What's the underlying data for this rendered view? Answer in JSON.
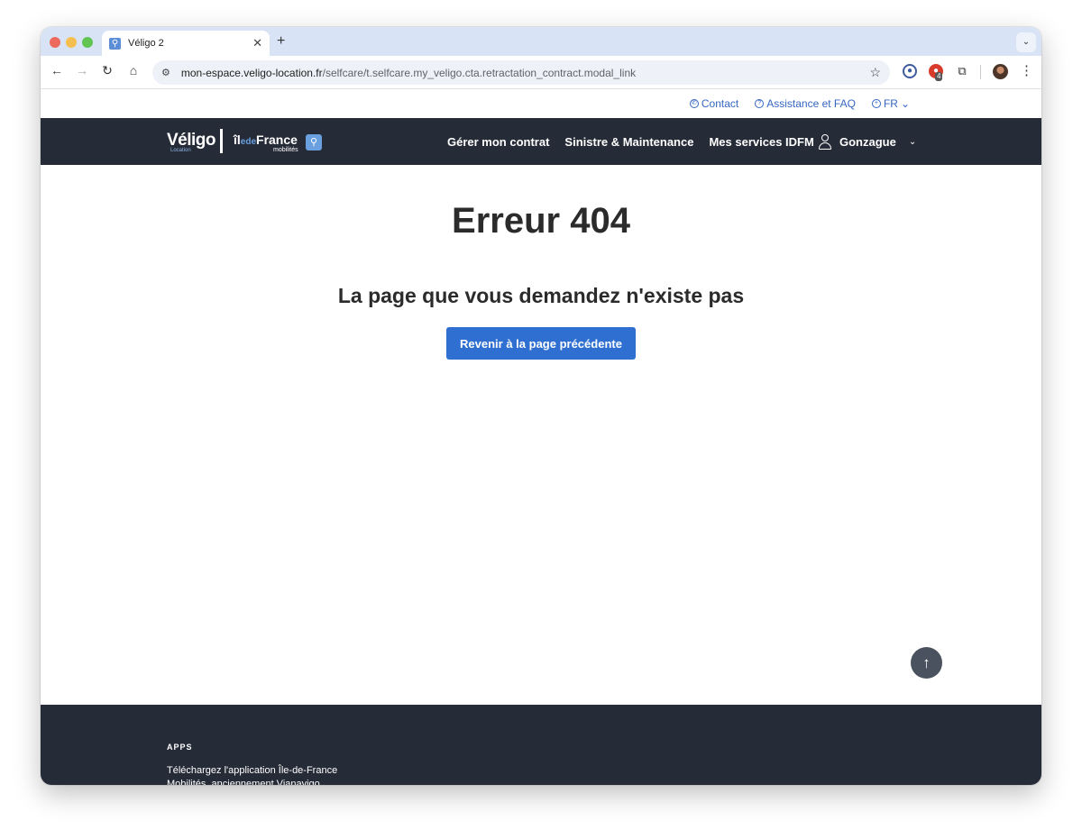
{
  "browser": {
    "tab_title": "Véligo 2",
    "tab_favicon": "person-icon",
    "close_glyph": "✕",
    "new_tab_glyph": "+",
    "tab_menu_glyph": "⌄",
    "url_host": "mon-espace.veligo-location.fr",
    "url_path": "/selfcare/t.selfcare.my_veligo.cta.retractation_contract.modal_link",
    "extension_badge": "4"
  },
  "topbar": {
    "contact": "Contact",
    "faq": "Assistance et FAQ",
    "language": "FR"
  },
  "header": {
    "logo_veligo": "Véligo",
    "logo_veligo_sub": "Location",
    "logo_idf_main": "îlede",
    "logo_idf_de": "",
    "logo_idf_end": "France",
    "logo_idf_sub": "mobilités",
    "nav": [
      {
        "label": "Gérer mon contrat"
      },
      {
        "label": "Sinistre & Maintenance"
      },
      {
        "label": "Mes services IDFM"
      }
    ],
    "user_name": "Gonzague"
  },
  "main": {
    "error_title": "Erreur 404",
    "error_subtitle": "La page que vous demandez n'existe pas",
    "back_button": "Revenir à la page précédente"
  },
  "footer": {
    "apps_heading": "APPS",
    "apps_text": "Téléchargez l'application Île-de-France Mobilités, anciennement Vianavigo"
  },
  "colors": {
    "nav_bg": "#252b37",
    "accent": "#2f6fd1",
    "link": "#3566c0"
  }
}
